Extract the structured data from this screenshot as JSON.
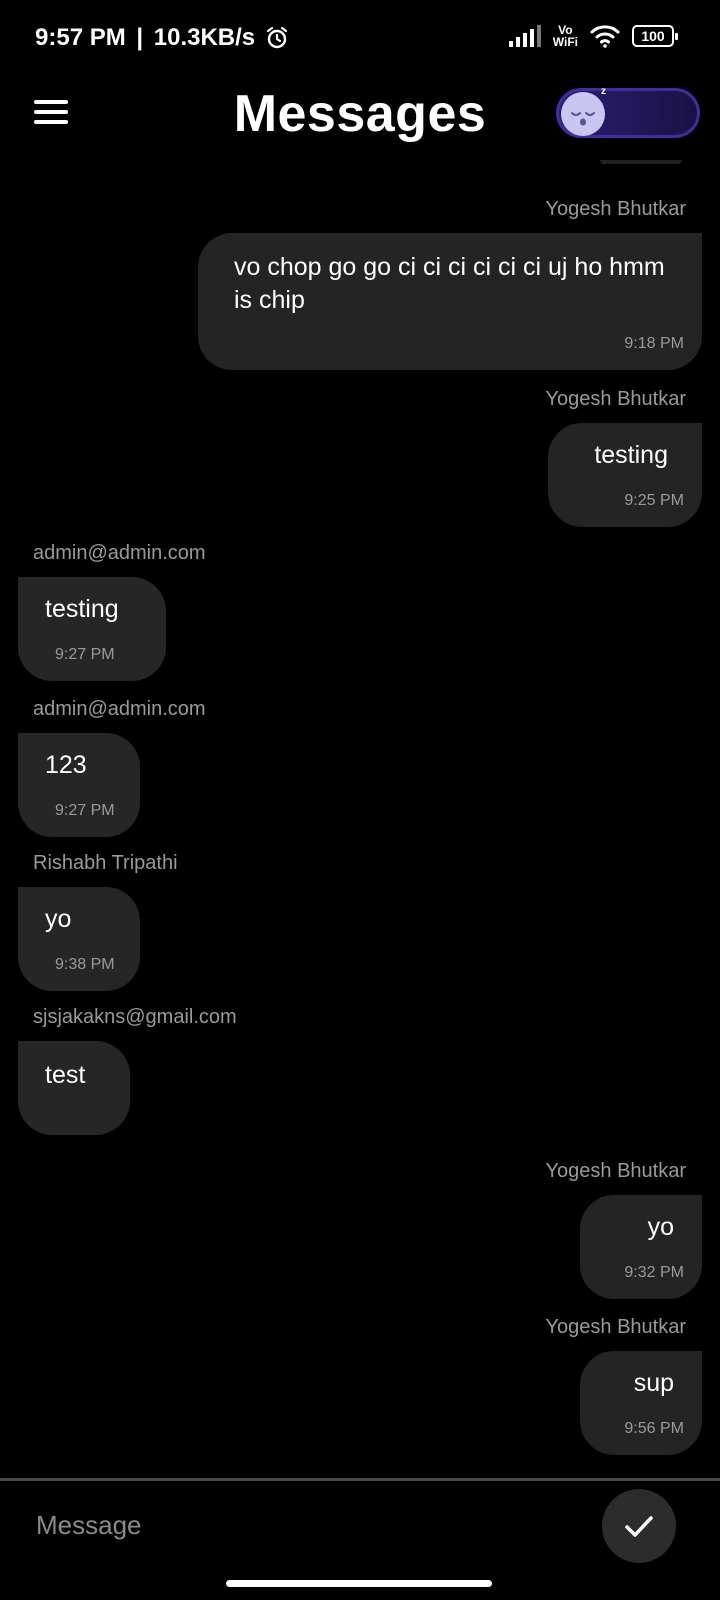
{
  "status_bar": {
    "time": "9:57 PM",
    "network_speed": "10.3KB/s",
    "alarm_icon": "alarm-icon",
    "signal_icon": "signal-bars-icon",
    "vowifi_top": "Vo",
    "vowifi_bottom": "WiFi",
    "wifi_icon": "wifi-icon",
    "battery": "100"
  },
  "header": {
    "menu_icon": "hamburger-menu-icon",
    "title": "Messages",
    "theme_toggle_icon": "sleeping-moon-icon",
    "theme_toggle_badge": "z"
  },
  "messages": [
    {
      "sender": "Yogesh Bhutkar",
      "text": "vo chop go go ci ci ci ci ci ci uj ho hmm is chip",
      "time": "9:18 PM",
      "mine": true
    },
    {
      "sender": "Yogesh Bhutkar",
      "text": "testing",
      "time": "9:25 PM",
      "mine": true
    },
    {
      "sender": "admin@admin.com",
      "text": "testing",
      "time": "9:27 PM",
      "mine": false
    },
    {
      "sender": "admin@admin.com",
      "text": "123",
      "time": "9:27 PM",
      "mine": false
    },
    {
      "sender": "Rishabh Tripathi",
      "text": "yo",
      "time": "9:38 PM",
      "mine": false
    },
    {
      "sender": "sjsjakakns@gmail.com",
      "text": "test",
      "time": "",
      "mine": false
    },
    {
      "sender": "Yogesh Bhutkar",
      "text": "yo",
      "time": "9:32 PM",
      "mine": true
    },
    {
      "sender": "Yogesh Bhutkar",
      "text": "sup",
      "time": "9:56 PM",
      "mine": true
    }
  ],
  "composer": {
    "placeholder": "Message",
    "value": "",
    "send_icon": "checkmark-icon"
  },
  "colors": {
    "background": "#000000",
    "bubble": "#262626",
    "secondary_text": "#9a9a9a",
    "toggle_accent": "#3c2f9e"
  }
}
